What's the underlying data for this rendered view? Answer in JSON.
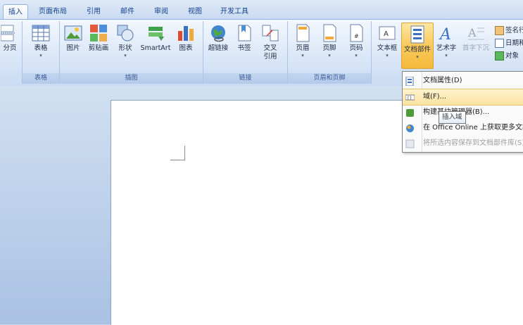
{
  "tabs": [
    "插入",
    "页面布局",
    "引用",
    "邮件",
    "审阅",
    "视图",
    "开发工具"
  ],
  "groups": {
    "tables": "表格",
    "illustrations": "插图",
    "links": "链接",
    "header_footer": "页眉和页脚"
  },
  "buttons": {
    "page_break": "分页",
    "table": "表格",
    "picture": "图片",
    "clipart": "剪贴画",
    "shapes": "形状",
    "smartart": "SmartArt",
    "chart": "图表",
    "hyperlink": "超链接",
    "bookmark": "书签",
    "crossref_1": "交叉",
    "crossref_2": "引用",
    "header": "页眉",
    "footer": "页脚",
    "page_number": "页码",
    "textbox": "文本框",
    "quick_parts": "文档部件",
    "wordart": "艺术字",
    "dropcap": "首字下沉",
    "signature": "签名行",
    "datetime": "日期和时间",
    "object": "对象"
  },
  "dropdown": {
    "items": [
      {
        "label": "文档属性(D)",
        "enabled": true
      },
      {
        "label": "域(F)...",
        "enabled": true,
        "hover": true
      },
      {
        "label": "构建基块管理器(B)...",
        "enabled": true
      },
      {
        "label": "在 Office Online 上获取更多文档部件",
        "enabled": true
      },
      {
        "label": "将所选内容保存到文档部件库(S)...",
        "enabled": false
      }
    ],
    "tooltip": "插入域"
  },
  "colors": {
    "accent": "#15428b",
    "highlight": "#f9c95a",
    "ribbon": "#d9e6f7"
  }
}
